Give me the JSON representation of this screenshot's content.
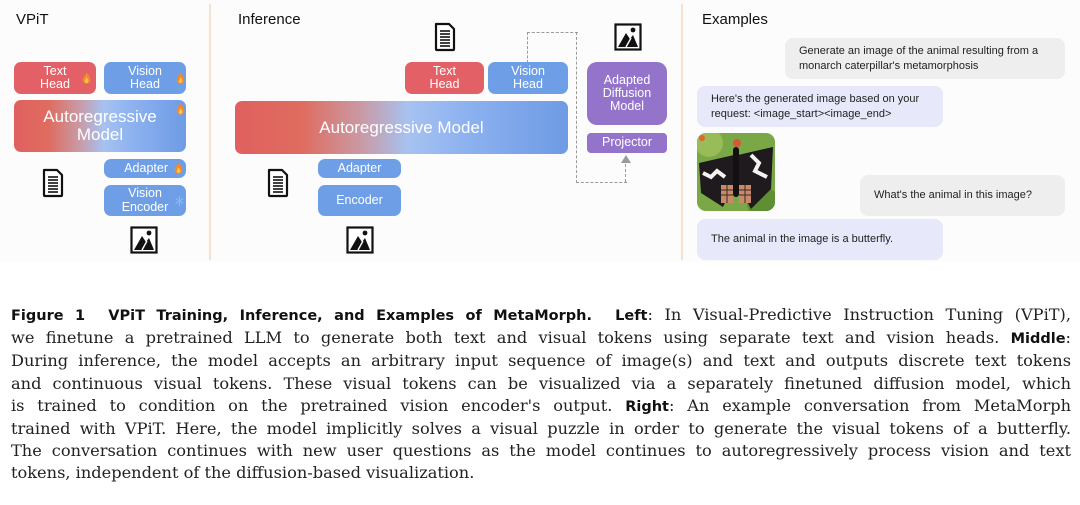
{
  "panels": {
    "left": {
      "title": "VPiT",
      "text_head": "Text\nHead",
      "vision_head": "Vision\nHead",
      "model": "Autoregressive\nModel",
      "adapter": "Adapter",
      "vision_encoder": "Vision\nEncoder"
    },
    "middle": {
      "title": "Inference",
      "text_head": "Text\nHead",
      "vision_head": "Vision\nHead",
      "model": "Autoregressive Model",
      "adapter": "Adapter",
      "encoder": "Encoder",
      "diffusion": "Adapted\nDiffusion\nModel",
      "projector": "Projector"
    },
    "right": {
      "title": "Examples",
      "messages": [
        {
          "role": "user",
          "text": "Generate an image of the animal resulting from a monarch caterpillar's metamorphosis"
        },
        {
          "role": "assistant",
          "text": "Here's the generated image based on your request: <image_start><image_end>"
        },
        {
          "role": "user",
          "text": "What's the animal in this image?"
        },
        {
          "role": "assistant",
          "text": "The animal in the image is a butterfly."
        }
      ]
    }
  },
  "caption": {
    "label": "Figure 1",
    "title": "VPiT Training, Inference, and Examples of MetaMorph.",
    "left_label": "Left",
    "left_text_1": ": In Visual-Predictive Instruction Tuning (VPiT),",
    "line2a": "we finetune a pretrained LLM to generate both text and visual tokens using separate text and vision heads.",
    "middle_label": "Middle",
    "line2b": ":",
    "line3": "During inference, the model accepts an arbitrary input sequence of image(s) and text and outputs discrete text tokens",
    "line4": "and continuous visual tokens. These visual tokens can be visualized via a separately finetuned diffusion model, which",
    "line5a": "is trained to condition on the pretrained vision encoder's output.",
    "right_label": "Right",
    "line5b": ": An example conversation from MetaMorph",
    "line6": "trained with VPiT. Here, the model implicitly solves a visual puzzle in order to generate the visual tokens of a butterfly.",
    "line7": "The conversation continues with new user questions as the model continues to autoregressively process vision and text",
    "line8": "tokens, independent of the diffusion-based visualization."
  },
  "icons": {
    "flame": "flame-icon (trainable)",
    "snowflake": "snowflake-icon (frozen)",
    "document": "document-icon",
    "image": "image-icon"
  }
}
